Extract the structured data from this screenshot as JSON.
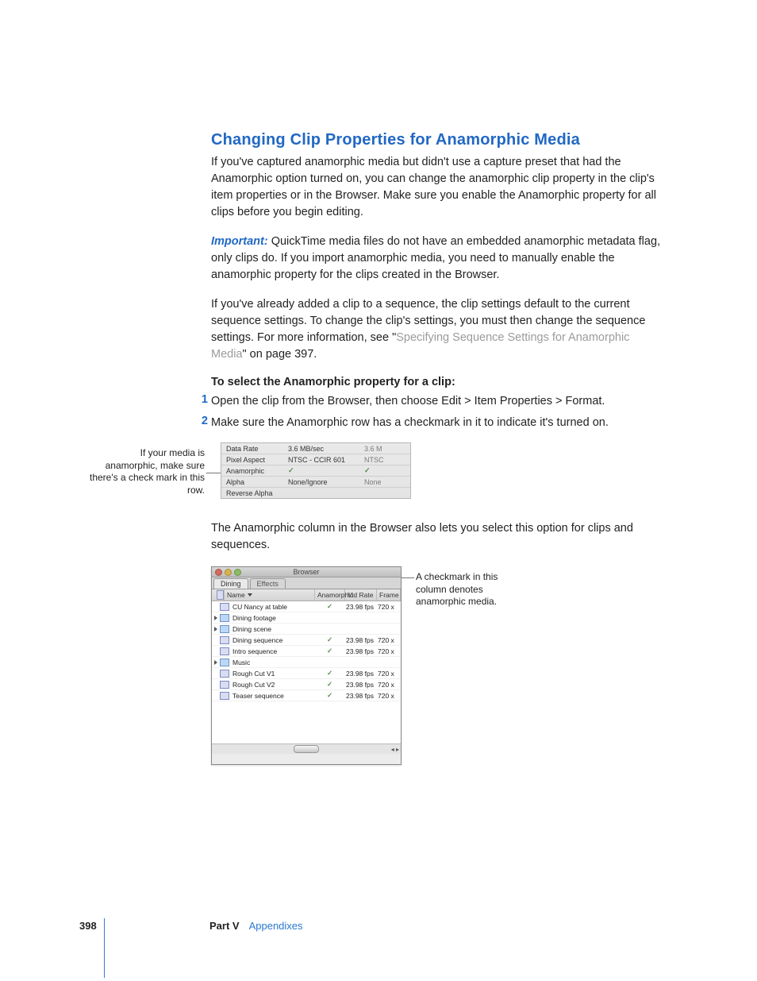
{
  "heading": "Changing Clip Properties for Anamorphic Media",
  "para1": "If you've captured anamorphic media but didn't use a capture preset that had the Anamorphic option turned on, you can change the anamorphic clip property in the clip's item properties or in the Browser. Make sure you enable the Anamorphic property for all clips before you begin editing.",
  "important_label": "Important:",
  "important_text": "  QuickTime media files do not have an embedded anamorphic metadata flag, only clips do. If you import anamorphic media, you need to manually enable the anamorphic property for the clips created in the Browser.",
  "para3_a": "If you've already added a clip to a sequence, the clip settings default to the current sequence settings. To change the clip's settings, you must then change the sequence settings. For more information, see \"",
  "para3_xref": "Specifying Sequence Settings for Anamorphic Media",
  "para3_b": "\" on page 397.",
  "task_heading": "To select the Anamorphic property for a clip:",
  "steps": {
    "s1": {
      "num": "1",
      "text": "Open the clip from the Browser, then choose Edit > Item Properties > Format."
    },
    "s2": {
      "num": "2",
      "text": "Make sure the Anamorphic row has a checkmark in it to indicate it's turned on."
    }
  },
  "props_callout": "If your media is anamorphic, make sure there's a check mark in this row.",
  "props_rows": {
    "r0": {
      "label": "Data Rate",
      "v1": "3.6 MB/sec",
      "v2": "3.6 M"
    },
    "r1": {
      "label": "Pixel Aspect",
      "v1": "NTSC - CCIR 601",
      "v2": "NTSC"
    },
    "r2": {
      "label": "Anamorphic",
      "v1": "✓",
      "v2": "✓"
    },
    "r3": {
      "label": "Alpha",
      "v1": "None/Ignore",
      "v2": "None"
    },
    "r4": {
      "label": "Reverse Alpha",
      "v1": "",
      "v2": ""
    }
  },
  "para_after_props": "The Anamorphic column in the Browser also lets you select this option for clips and sequences.",
  "browser_callout": "A checkmark in this column denotes anamorphic media.",
  "browser": {
    "title": "Browser",
    "tabs": {
      "t0": "Dining",
      "t1": "Effects"
    },
    "columns": {
      "name": "Name",
      "ana": "Anamorphic",
      "vid": "Vid Rate",
      "frame": "Frame"
    },
    "rows": {
      "r0": {
        "name": "CU Nancy at table",
        "ana": "✓",
        "vid": "23.98 fps",
        "frame": "720 x",
        "type": "clip",
        "expand": false
      },
      "r1": {
        "name": "Dining footage",
        "ana": "",
        "vid": "",
        "frame": "",
        "type": "folder",
        "expand": true
      },
      "r2": {
        "name": "Dining scene",
        "ana": "",
        "vid": "",
        "frame": "",
        "type": "folder",
        "expand": true
      },
      "r3": {
        "name": "Dining sequence",
        "ana": "✓",
        "vid": "23.98 fps",
        "frame": "720 x",
        "type": "clip",
        "expand": false
      },
      "r4": {
        "name": "Intro sequence",
        "ana": "✓",
        "vid": "23.98 fps",
        "frame": "720 x",
        "type": "clip",
        "expand": false
      },
      "r5": {
        "name": "Music",
        "ana": "",
        "vid": "",
        "frame": "",
        "type": "folder",
        "expand": true
      },
      "r6": {
        "name": "Rough Cut V1",
        "ana": "✓",
        "vid": "23.98 fps",
        "frame": "720 x",
        "type": "clip",
        "expand": false
      },
      "r7": {
        "name": "Rough Cut V2",
        "ana": "✓",
        "vid": "23.98 fps",
        "frame": "720 x",
        "type": "clip",
        "expand": false
      },
      "r8": {
        "name": "Teaser sequence",
        "ana": "✓",
        "vid": "23.98 fps",
        "frame": "720 x",
        "type": "clip",
        "expand": false
      }
    }
  },
  "footer": {
    "page": "398",
    "part": "Part V",
    "section": "Appendixes"
  }
}
